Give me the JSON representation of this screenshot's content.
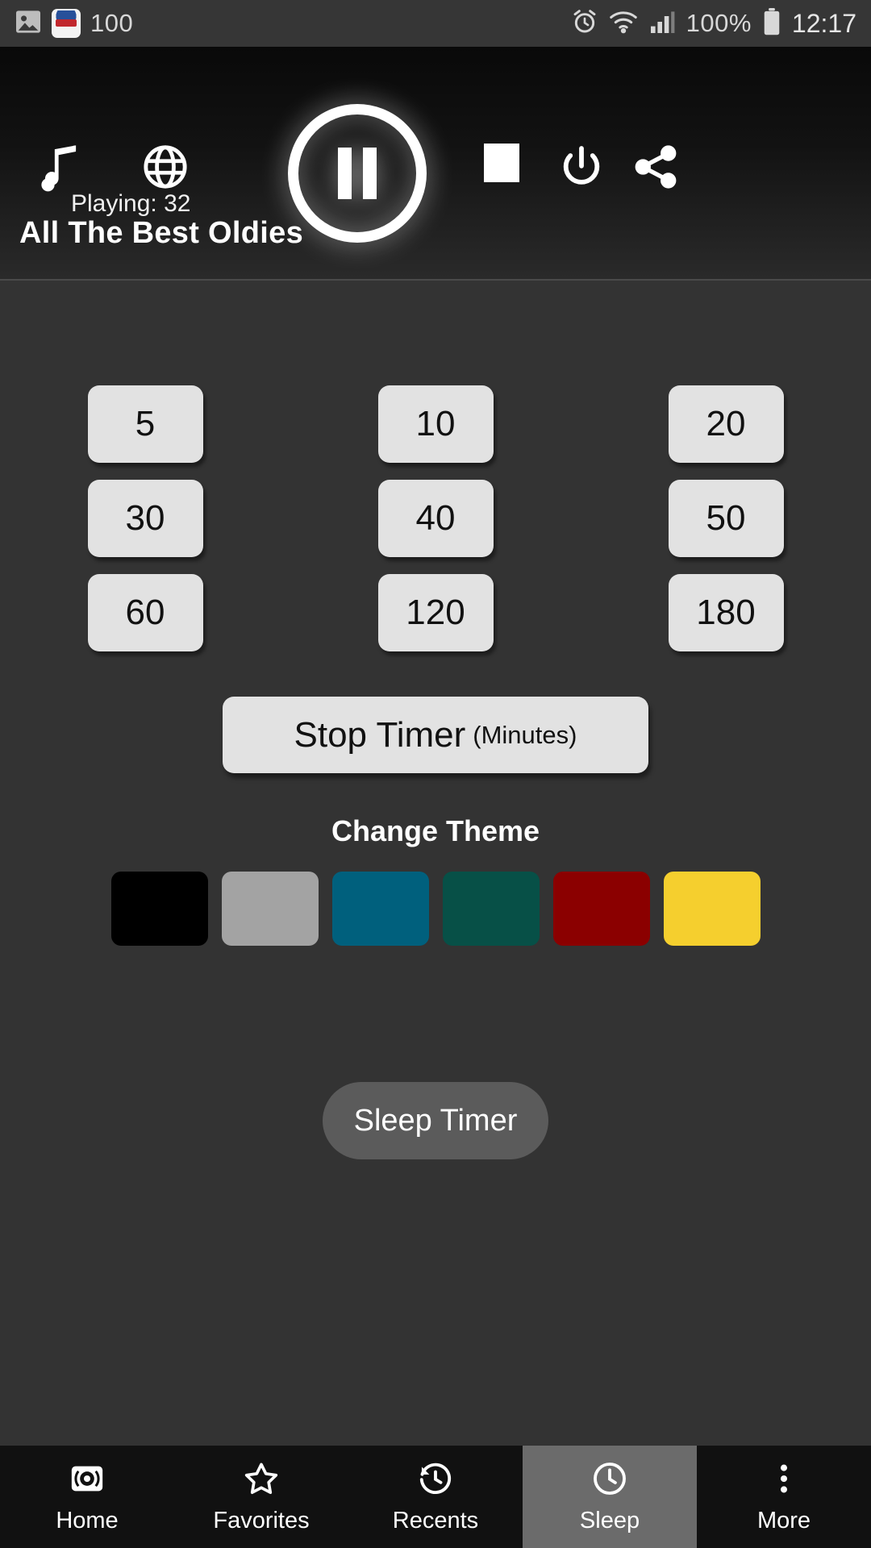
{
  "status_bar": {
    "battery_text": "100%",
    "signal_text": "100",
    "time": "12:17",
    "icons": [
      "image-icon",
      "app-badge-icon",
      "alarm-icon",
      "wifi-icon",
      "cellular-icon",
      "battery-icon"
    ]
  },
  "player": {
    "playing_label": "Playing: 32",
    "station_title": "All The Best Oldies",
    "controls": [
      {
        "name": "music-note-icon",
        "label": "Music"
      },
      {
        "name": "globe-icon",
        "label": "Globe"
      },
      {
        "name": "pause-icon",
        "label": "Pause"
      },
      {
        "name": "stop-icon",
        "label": "Stop"
      },
      {
        "name": "power-icon",
        "label": "Power"
      },
      {
        "name": "share-icon",
        "label": "Share"
      }
    ]
  },
  "timer": {
    "options": [
      "5",
      "10",
      "20",
      "30",
      "40",
      "50",
      "60",
      "120",
      "180"
    ],
    "stop_main": "Stop Timer",
    "stop_sub": "(Minutes)"
  },
  "theme": {
    "label": "Change Theme",
    "swatches": [
      {
        "name": "theme-black",
        "color": "#000000"
      },
      {
        "name": "theme-gray",
        "color": "#a3a3a3"
      },
      {
        "name": "theme-blue",
        "color": "#00607d"
      },
      {
        "name": "theme-green",
        "color": "#075047"
      },
      {
        "name": "theme-red",
        "color": "#8b0000"
      },
      {
        "name": "theme-yellow",
        "color": "#f5cf2e"
      }
    ]
  },
  "sleep_button": {
    "label": "Sleep Timer"
  },
  "nav": {
    "items": [
      {
        "label": "Home",
        "icon": "radio-icon",
        "active": false
      },
      {
        "label": "Favorites",
        "icon": "star-icon",
        "active": false
      },
      {
        "label": "Recents",
        "icon": "history-icon",
        "active": false
      },
      {
        "label": "Sleep",
        "icon": "clock-icon",
        "active": true
      },
      {
        "label": "More",
        "icon": "more-vertical-icon",
        "active": false
      }
    ]
  }
}
